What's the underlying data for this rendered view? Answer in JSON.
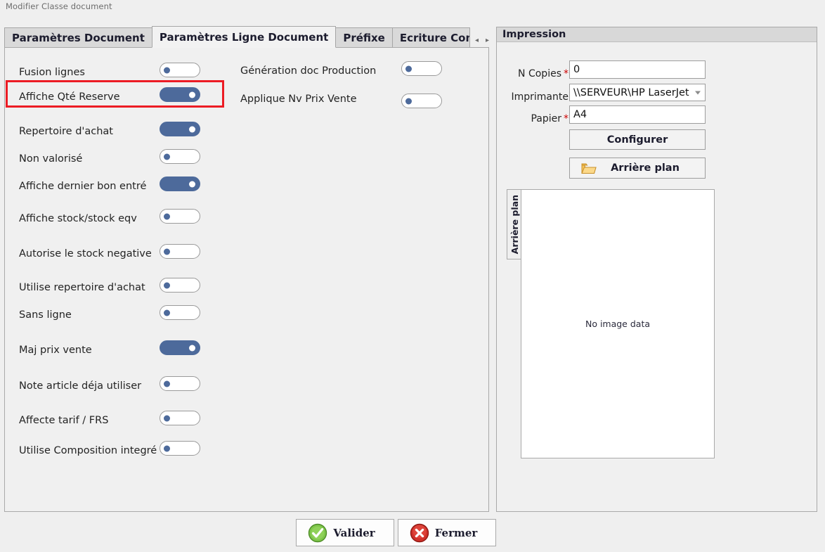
{
  "window": {
    "caption": "Modifier Classe document"
  },
  "tabs": {
    "items": [
      {
        "label": "Paramètres Document",
        "active": false
      },
      {
        "label": "Paramètres Ligne Document",
        "active": true
      },
      {
        "label": "Préfixe",
        "active": false
      },
      {
        "label": "Ecriture Comptable",
        "active": false
      }
    ],
    "nav_prev": "◂",
    "nav_next": "▸"
  },
  "settings_left": {
    "options": [
      {
        "label": "Fusion lignes",
        "state": "off"
      },
      {
        "label": "Affiche Qté Reserve",
        "state": "on"
      },
      {
        "label": "Repertoire d'achat",
        "state": "on"
      },
      {
        "label": "Non valorisé",
        "state": "off"
      },
      {
        "label": "Affiche dernier bon entré",
        "state": "on"
      },
      {
        "label": "Affiche stock/stock eqv",
        "state": "off"
      },
      {
        "label": "Autorise le stock negative",
        "state": "off"
      },
      {
        "label": "Utilise repertoire d'achat",
        "state": "off"
      },
      {
        "label": "Sans ligne",
        "state": "off"
      },
      {
        "label": "Maj prix vente",
        "state": "on"
      },
      {
        "label": "Note article déja utiliser",
        "state": "off"
      },
      {
        "label": "Affecte tarif / FRS",
        "state": "off"
      },
      {
        "label": "Utilise Composition integré",
        "state": "off"
      }
    ]
  },
  "settings_middle": {
    "options": [
      {
        "label": "Génération doc Production",
        "state": "off"
      },
      {
        "label": "Applique Nv Prix Vente",
        "state": "off"
      }
    ]
  },
  "highlight": {
    "target_label": "Affiche Qté Reserve",
    "color": "#ec1c24"
  },
  "impression": {
    "title": "Impression",
    "fields": {
      "copies_label": "N Copies",
      "copies_required": "*",
      "copies_value": "0",
      "printer_label": "Imprimante",
      "printer_value": "\\\\SERVEUR\\HP LaserJet",
      "paper_label": "Papier",
      "paper_required": "*",
      "paper_value": "A4"
    },
    "configure_button": "Configurer",
    "background_button": "Arrière plan",
    "preview_tab_label": "Arrière plan",
    "preview_empty_text": "No image data"
  },
  "footer": {
    "validate_label": "Valider",
    "close_label": "Fermer"
  },
  "colors": {
    "toggle_on": "#4d6a9b",
    "highlight": "#ec1c24",
    "panel_bg": "#f0f0f0",
    "window_bg": "#efefef"
  }
}
